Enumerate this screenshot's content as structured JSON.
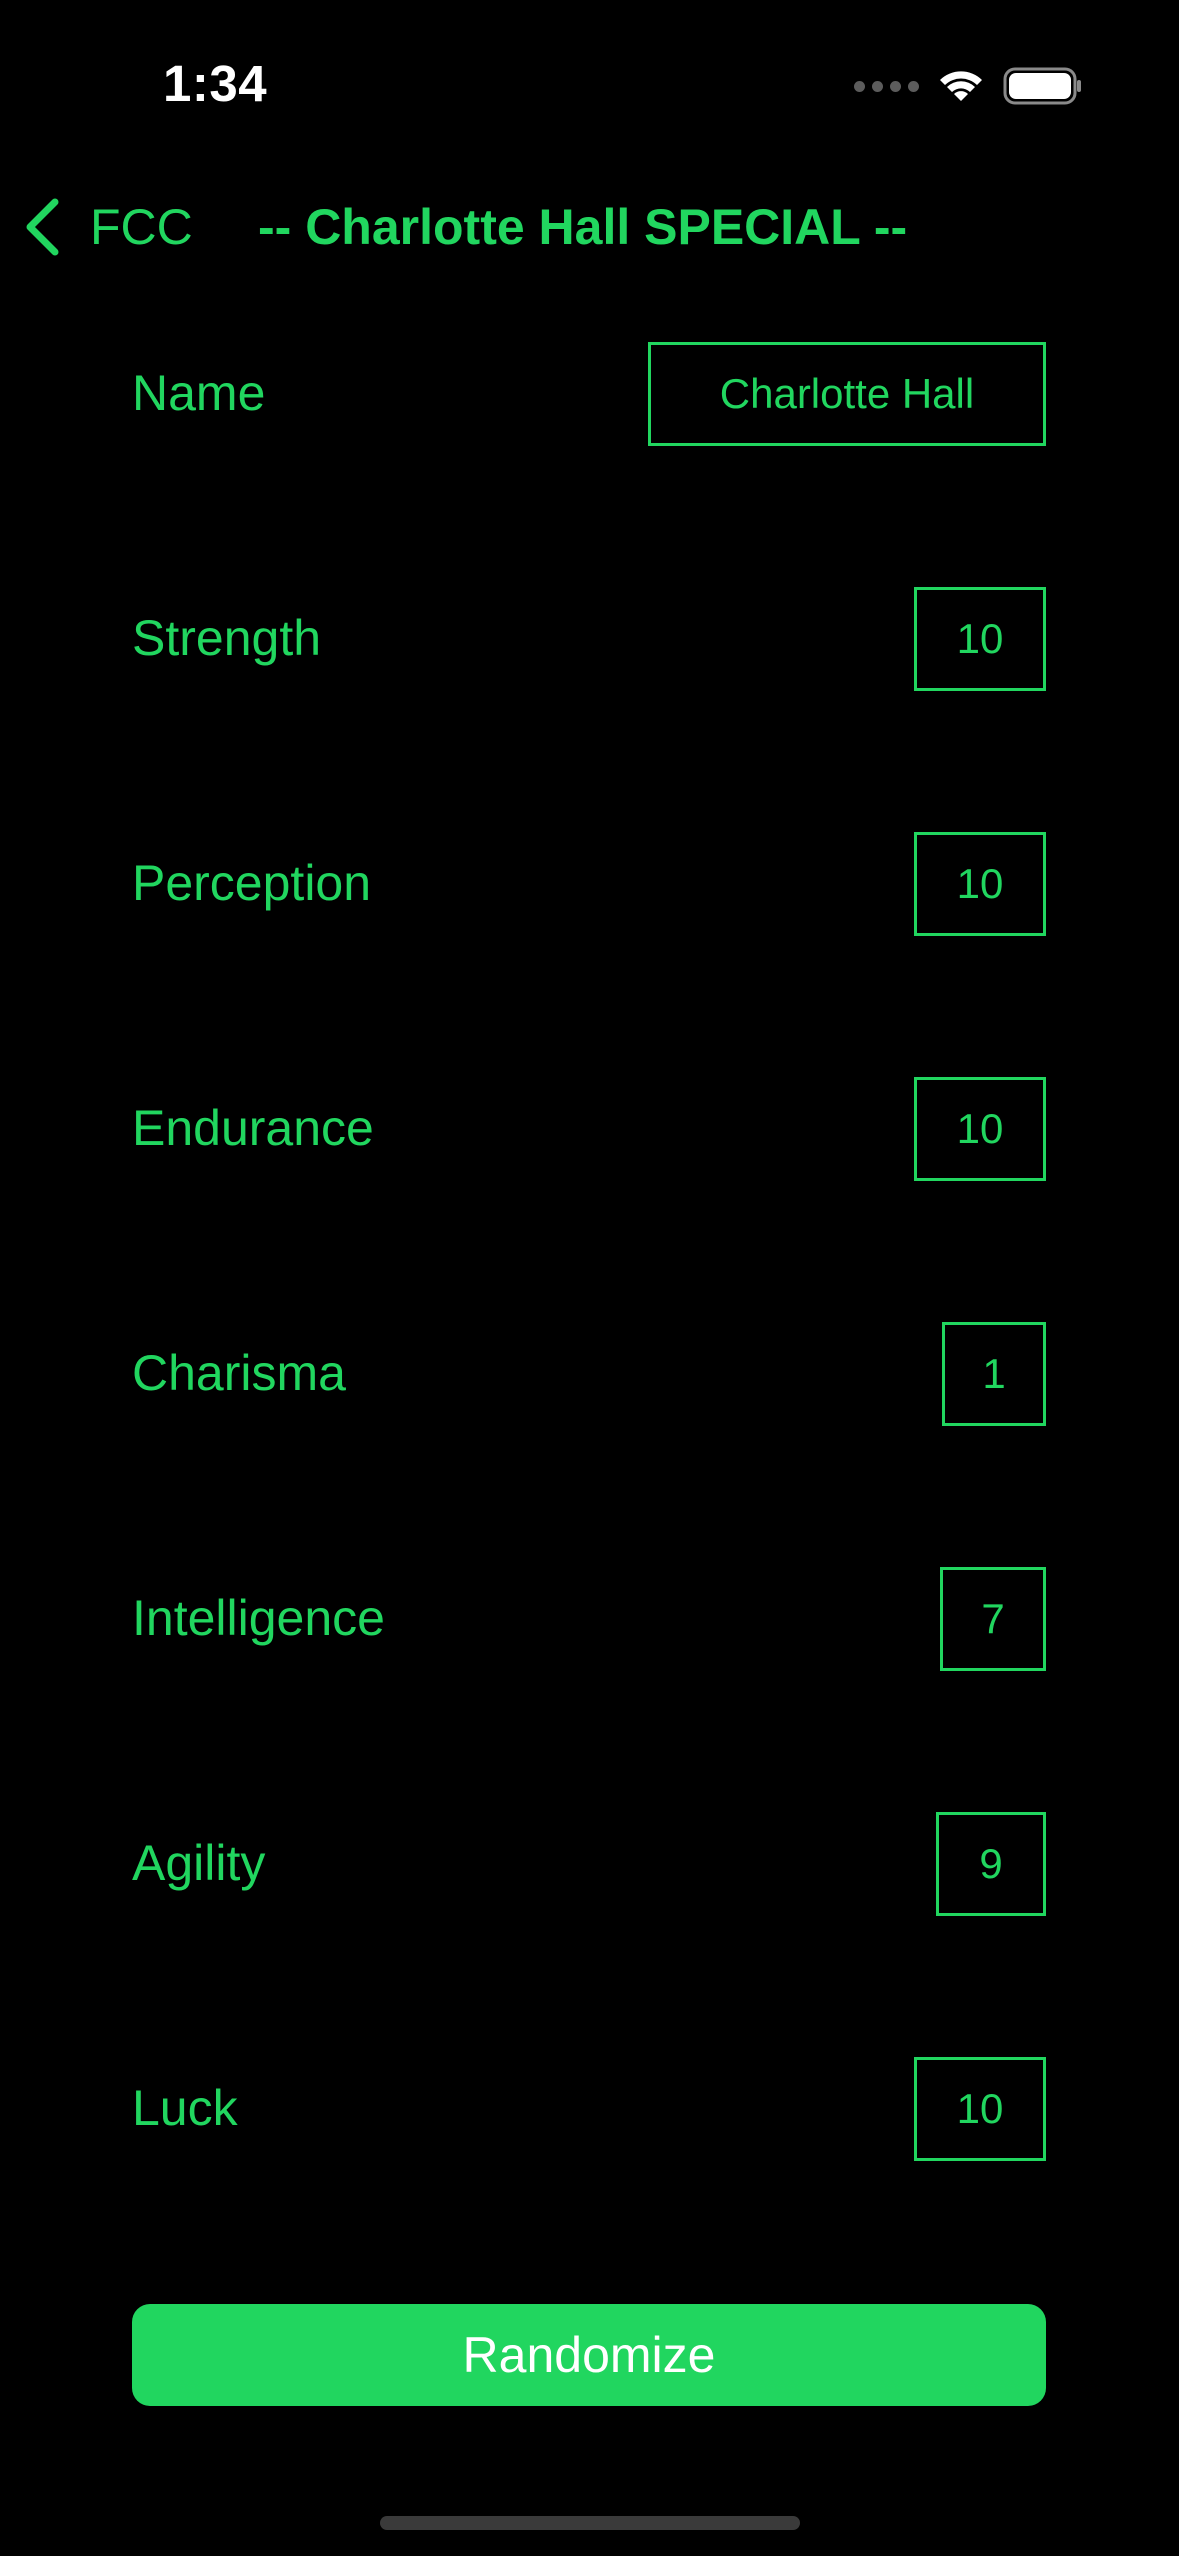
{
  "status_bar": {
    "time": "1:34"
  },
  "nav": {
    "back_label": "FCC",
    "title": "-- Charlotte Hall SPECIAL --"
  },
  "form": {
    "name": {
      "label": "Name",
      "value": "Charlotte Hall"
    },
    "stats": [
      {
        "label": "Strength",
        "value": "10"
      },
      {
        "label": "Perception",
        "value": "10"
      },
      {
        "label": "Endurance",
        "value": "10"
      },
      {
        "label": "Charisma",
        "value": "1"
      },
      {
        "label": "Intelligence",
        "value": "7"
      },
      {
        "label": "Agility",
        "value": "9"
      },
      {
        "label": "Luck",
        "value": "10"
      }
    ]
  },
  "actions": {
    "randomize_label": "Randomize"
  },
  "colors": {
    "accent": "#21d65f",
    "background": "#000000"
  }
}
